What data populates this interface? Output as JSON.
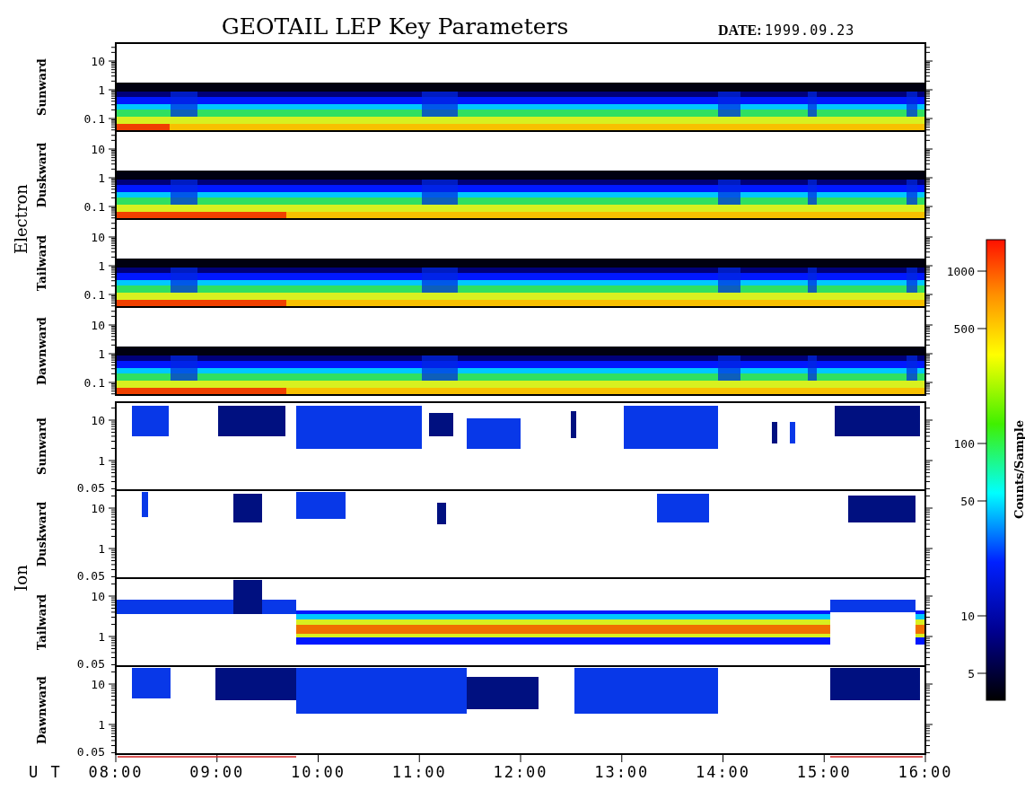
{
  "title": "GEOTAIL LEP Key Parameters",
  "date": {
    "label": "DATE:",
    "value": "1999.09.23"
  },
  "groups": [
    {
      "label": "Electron",
      "kind": "electron",
      "panels": [
        {
          "label": "Sunward",
          "yticks": [
            "10",
            "1",
            "0.1"
          ]
        },
        {
          "label": "Duskward",
          "yticks": [
            "10",
            "1",
            "0.1"
          ]
        },
        {
          "label": "Tailward",
          "yticks": [
            "10",
            "1",
            "0.1"
          ]
        },
        {
          "label": "Dawnward",
          "yticks": [
            "10",
            "1",
            "0.1"
          ]
        }
      ]
    },
    {
      "label": "Ion",
      "kind": "ion",
      "panels": [
        {
          "label": "Sunward",
          "yticks": [
            "10",
            "1",
            "0.05"
          ]
        },
        {
          "label": "Duskward",
          "yticks": [
            "10",
            "1",
            "0.05"
          ]
        },
        {
          "label": "Tailward",
          "yticks": [
            "10",
            "1",
            "0.05"
          ]
        },
        {
          "label": "Dawnward",
          "yticks": [
            "10",
            "1",
            "0.05"
          ]
        }
      ]
    }
  ],
  "time_axis": {
    "label": "U T",
    "ticks": [
      "08:00",
      "09:00",
      "10:00",
      "11:00",
      "12:00",
      "13:00",
      "14:00",
      "15:00",
      "16:00"
    ]
  },
  "color_scale": {
    "label": "Counts/Sample",
    "ticks": [
      "1000",
      "500",
      "100",
      "50",
      "10",
      "5"
    ]
  }
}
